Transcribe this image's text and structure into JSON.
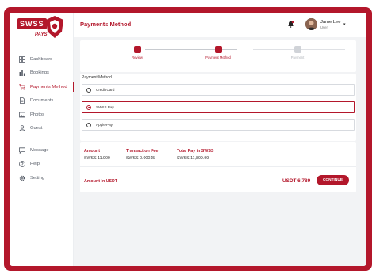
{
  "brand": {
    "logo_text": "SWSS",
    "logo_sub": "PAYS",
    "accent": "#b3172b"
  },
  "sidebar": {
    "items": [
      {
        "label": "Dashboard",
        "icon": "dashboard-icon"
      },
      {
        "label": "Bookings",
        "icon": "bar-chart-icon"
      },
      {
        "label": "Payments Method",
        "icon": "cart-icon",
        "active": true
      },
      {
        "label": "Documents",
        "icon": "document-icon"
      },
      {
        "label": "Photos",
        "icon": "image-icon"
      },
      {
        "label": "Guest",
        "icon": "user-icon"
      },
      {
        "label": "Message",
        "icon": "message-icon"
      },
      {
        "label": "Help",
        "icon": "help-icon"
      },
      {
        "label": "Setting",
        "icon": "gear-icon"
      }
    ]
  },
  "header": {
    "title": "Payments Method",
    "user": {
      "name": "Jame Lee",
      "role": "User"
    }
  },
  "steps": [
    {
      "label": "Review",
      "state": "done"
    },
    {
      "label": "Payment Method",
      "state": "active"
    },
    {
      "label": "Payment",
      "state": "inactive"
    }
  ],
  "payment": {
    "title": "Payment Method",
    "options": [
      {
        "label": "Credit Card",
        "selected": false
      },
      {
        "label": "SWSS Pay",
        "selected": true
      },
      {
        "label": "Apple Pay",
        "selected": false
      }
    ]
  },
  "summary": {
    "amount_label": "Amount",
    "amount_value": "SWSS 11.900",
    "fee_label": "Transaction Fee",
    "fee_value": "SWSS 0.00015",
    "total_label": "Total Pay in SWSS",
    "total_value": "SWSS 11,899.99",
    "usdt_label": "Amount In USDT",
    "usdt_value": "USDT 6,789",
    "continue_label": "CONTINUE"
  }
}
